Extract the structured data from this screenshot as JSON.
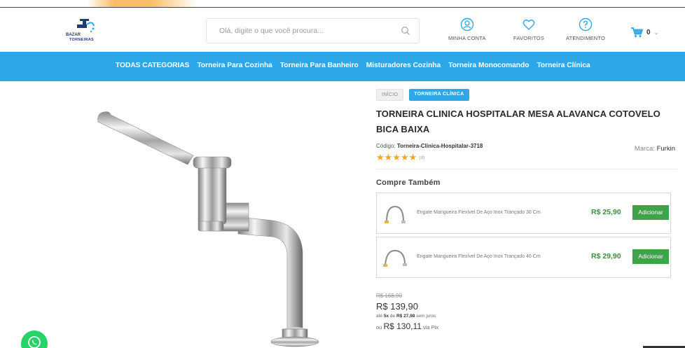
{
  "header": {
    "logo_line1": "BAZAR",
    "logo_line2": "TORNEIRAS",
    "search_placeholder": "Olá, digite o que você procura...",
    "links": [
      {
        "label": "MINHA CONTA",
        "icon": "user-icon"
      },
      {
        "label": "FAVORITOS",
        "icon": "heart-icon"
      },
      {
        "label": "ATENDIMENTO",
        "icon": "help-icon"
      }
    ],
    "cart_count": "0",
    "cart_chevron": "⌄"
  },
  "nav": {
    "items": [
      "TODAS CATEGORIAS",
      "Torneira Para Cozinha",
      "Torneira Para Banheiro",
      "Misturadores Cozinha",
      "Torneira Monocomando",
      "Torneira Clínica"
    ]
  },
  "breadcrumb": {
    "home": "INÍCIO",
    "current": "TORNEIRA CLÍNICA"
  },
  "product": {
    "title": "TORNEIRA CLINICA HOSPITALAR MESA ALAVANCA COTOVELO BICA BAIXA",
    "code_label": "Código:",
    "code_value": "Torneira-Clinica-Hospitalar-3718",
    "brand_label": "Marca:",
    "brand_value": "Furkin",
    "rating_stars": 5,
    "rating_count": "(0)",
    "old_price": "R$ 168,90",
    "price": "R$ 139,90",
    "installments_prefix": "até",
    "installments_count": "5x",
    "installments_mid": "de",
    "installments_value": "R$ 27,98",
    "installments_suffix": "sem juros",
    "pix_prefix": "ou",
    "pix_price": "R$ 130,11",
    "pix_suffix": "via Pix"
  },
  "cross_sell": {
    "title": "Compre Também",
    "items": [
      {
        "name": "Engate Mangueira Flexível De Aço Inox Trançado 30 Cm",
        "price": "R$ 25,90",
        "button": "Adicionar"
      },
      {
        "name": "Engate Mangueira Flexível De Aço Inox Trançado 40 Cm",
        "price": "R$ 29,90",
        "button": "Adicionar"
      }
    ]
  },
  "colors": {
    "nav_blue": "#2ea7e9",
    "price_green": "#3a8e3e",
    "button_green": "#3da44a",
    "star": "#f5a623",
    "whatsapp": "#25d366"
  }
}
